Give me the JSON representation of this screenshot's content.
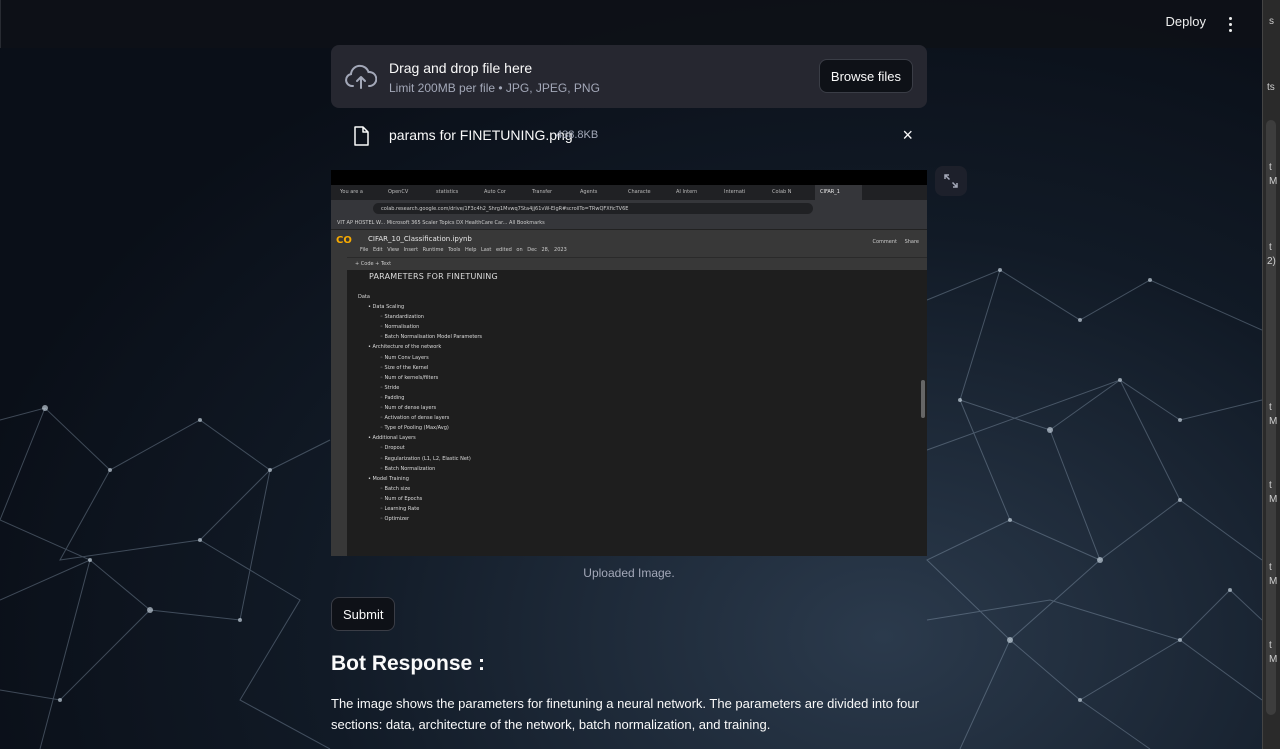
{
  "header": {
    "deploy_label": "Deploy",
    "menu_icon": "kebab-menu-icon"
  },
  "right_strip": [
    "s",
    "ts",
    "t",
    "M",
    "t",
    "2)",
    "t",
    "M",
    "t",
    "M",
    "t",
    "M",
    "t",
    "M"
  ],
  "uploader": {
    "title": "Drag and drop file here",
    "limit": "Limit 200MB per file • JPG, JPEG, PNG",
    "browse_label": "Browse files",
    "icon": "cloud-upload-icon"
  },
  "file": {
    "name": "params for FINETUNING.png",
    "size": "438.8KB",
    "icon": "file-icon",
    "close": "×"
  },
  "image": {
    "tabs": [
      "You are a",
      "OpenCV",
      "statistics",
      "Auto Cor",
      "Transfer",
      "Agents",
      "Characte",
      "AI Intern",
      "Internati",
      "Colab N",
      "CIFAR_1"
    ],
    "url": "colab.research.google.com/drive/1F3c4h2_Shrg1Mvwq7Sta4jj61vW-ElgR#scrollTo=TRwQFXficTV6E",
    "bookmarks": "VIT AP HOSTEL W...   Microsoft 365   Scaler Topics   DX HealthCare Car...                                                                                                                    All Bookmarks",
    "logo": "CO",
    "notebook": "CIFAR_10_Classification.ipynb",
    "menu": "File Edit View Insert Runtime Tools Help  Last edited on Dec 28, 2023",
    "head_buttons": "Comment  Share",
    "toolbar": "+ Code  + Text",
    "section_title": "PARAMETERS FOR FINETUNING",
    "outline": [
      {
        "level": 1,
        "text": "Data"
      },
      {
        "level": 2,
        "text": "• Data Scaling"
      },
      {
        "level": 3,
        "text": "◦ Standardization"
      },
      {
        "level": 3,
        "text": "◦ Normalisation"
      },
      {
        "level": 3,
        "text": "◦ Batch Normalisation Model Parameters"
      },
      {
        "level": 2,
        "text": "• Architecture of the network"
      },
      {
        "level": 3,
        "text": "◦ Num Conv Layers"
      },
      {
        "level": 3,
        "text": "◦ Size of the Kernel"
      },
      {
        "level": 3,
        "text": "◦ Num of kernels/filters"
      },
      {
        "level": 3,
        "text": "◦ Stride"
      },
      {
        "level": 3,
        "text": "◦ Padding"
      },
      {
        "level": 3,
        "text": "◦ Num of dense layers"
      },
      {
        "level": 3,
        "text": "◦ Activation of dense layers"
      },
      {
        "level": 3,
        "text": "◦ Type of Pooling (Max/Avg)"
      },
      {
        "level": 2,
        "text": "• Additional Layers"
      },
      {
        "level": 3,
        "text": "◦ Dropout"
      },
      {
        "level": 3,
        "text": "◦ Regularization (L1, L2, Elastic Net)"
      },
      {
        "level": 3,
        "text": "◦ Batch Normalization"
      },
      {
        "level": 2,
        "text": "• Model Training"
      },
      {
        "level": 3,
        "text": "◦ Batch size"
      },
      {
        "level": 3,
        "text": "◦ Num of Epochs"
      },
      {
        "level": 3,
        "text": "◦ Learning Rate"
      },
      {
        "level": 3,
        "text": "◦ Optimizer"
      }
    ],
    "caption": "Uploaded Image."
  },
  "submit_label": "Submit",
  "bot": {
    "heading": "Bot Response :",
    "text": "The image shows the parameters for finetuning a neural network. The parameters are divided into four sections: data, architecture of the network, batch normalization, and training."
  }
}
